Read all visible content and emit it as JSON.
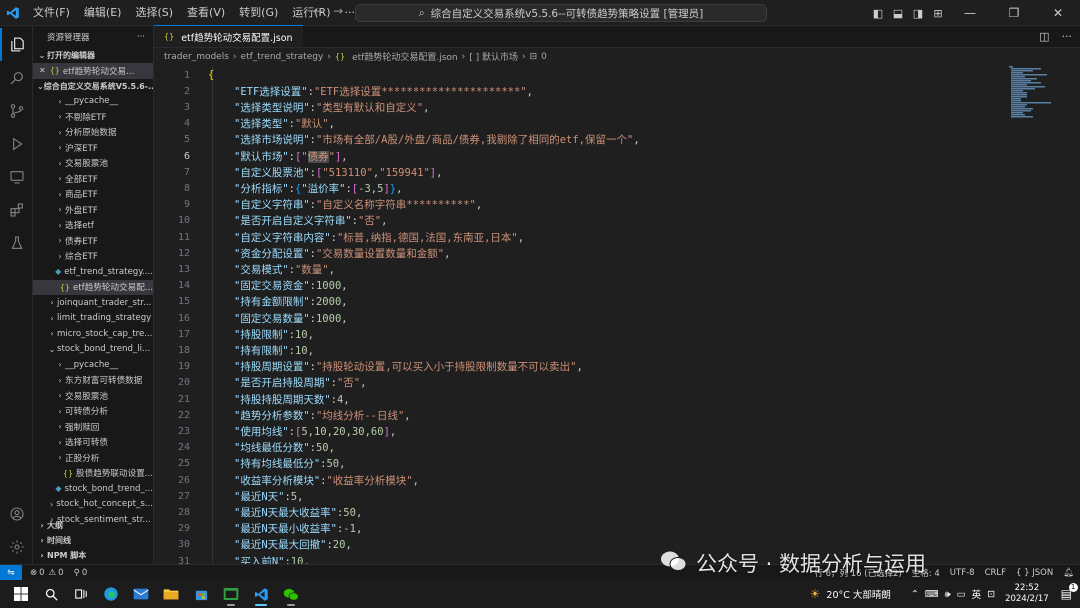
{
  "titlebar": {
    "menus": [
      "文件(F)",
      "编辑(E)",
      "选择(S)",
      "查看(V)",
      "转到(G)",
      "运行(R)",
      "···"
    ],
    "command_center": "综合自定义交易系统v5.5.6--可转债趋势策略设置 [管理员]"
  },
  "sidebar": {
    "header": "资源管理器",
    "header_more": "···",
    "open_editors": "打开的编辑器",
    "open_file": "etf趋势轮动交易...",
    "root": "综合自定义交易系统V5.5.6-...",
    "items": [
      {
        "label": "__pycache__",
        "indent": 2,
        "chev": "›",
        "type": "folder"
      },
      {
        "label": "不剔除ETF",
        "indent": 2,
        "chev": "›",
        "type": "folder"
      },
      {
        "label": "分析原始数据",
        "indent": 2,
        "chev": "›",
        "type": "folder"
      },
      {
        "label": "沪深ETF",
        "indent": 2,
        "chev": "›",
        "type": "folder"
      },
      {
        "label": "交易股票池",
        "indent": 2,
        "chev": "›",
        "type": "folder"
      },
      {
        "label": "全部ETF",
        "indent": 2,
        "chev": "›",
        "type": "folder"
      },
      {
        "label": "商品ETF",
        "indent": 2,
        "chev": "›",
        "type": "folder"
      },
      {
        "label": "外盘ETF",
        "indent": 2,
        "chev": "›",
        "type": "folder"
      },
      {
        "label": "选择etf",
        "indent": 2,
        "chev": "›",
        "type": "folder"
      },
      {
        "label": "债券ETF",
        "indent": 2,
        "chev": "›",
        "type": "folder"
      },
      {
        "label": "综合ETF",
        "indent": 2,
        "chev": "›",
        "type": "folder"
      },
      {
        "label": "etf_trend_strategy....",
        "indent": 2,
        "chev": "",
        "type": "py"
      },
      {
        "label": "etf趋势轮动交易配...",
        "indent": 2,
        "chev": "",
        "type": "json",
        "selected": true
      },
      {
        "label": "joinquant_trader_str...",
        "indent": 1,
        "chev": "›",
        "type": "folder"
      },
      {
        "label": "limit_trading_strategy",
        "indent": 1,
        "chev": "›",
        "type": "folder"
      },
      {
        "label": "micro_stock_cap_tre...",
        "indent": 1,
        "chev": "›",
        "type": "folder"
      },
      {
        "label": "stock_bond_trend_li...",
        "indent": 1,
        "chev": "⌄",
        "type": "folder"
      },
      {
        "label": "__pycache__",
        "indent": 2,
        "chev": "›",
        "type": "folder"
      },
      {
        "label": "东方财富可转债数据",
        "indent": 2,
        "chev": "›",
        "type": "folder"
      },
      {
        "label": "交易股票池",
        "indent": 2,
        "chev": "›",
        "type": "folder"
      },
      {
        "label": "可转债分析",
        "indent": 2,
        "chev": "›",
        "type": "folder"
      },
      {
        "label": "强制赎回",
        "indent": 2,
        "chev": "›",
        "type": "folder"
      },
      {
        "label": "选择可转债",
        "indent": 2,
        "chev": "›",
        "type": "folder"
      },
      {
        "label": "正股分析",
        "indent": 2,
        "chev": "›",
        "type": "folder"
      },
      {
        "label": "股债趋势联动设置...",
        "indent": 2,
        "chev": "",
        "type": "json"
      },
      {
        "label": "stock_bond_trend_...",
        "indent": 2,
        "chev": "",
        "type": "py"
      },
      {
        "label": "stock_hot_concept_s...",
        "indent": 1,
        "chev": "›",
        "type": "folder"
      },
      {
        "label": "stock_sentiment_str...",
        "indent": 1,
        "chev": "›",
        "type": "folder"
      }
    ],
    "bottom_sections": [
      "大纲",
      "时间线",
      "NPM 脚本"
    ]
  },
  "editor": {
    "tab_label": "etf趋势轮动交易配置.json",
    "breadcrumb": [
      "trader_models",
      "etf_trend_strategy",
      "etf趋势轮动交易配置.json",
      "[ ] 默认市场",
      "0"
    ],
    "current_line": 6,
    "lines": [
      {
        "n": "1",
        "text": "{"
      },
      {
        "n": "2",
        "text": "\"ETF选择设置\":\"ETF选择设置**********************\","
      },
      {
        "n": "3",
        "text": "\"选择类型说明\":\"类型有默认和自定义\","
      },
      {
        "n": "4",
        "text": "\"选择类型\":\"默认\","
      },
      {
        "n": "5",
        "text": "\"选择市场说明\":\"市场有全部/A股/外盘/商品/债券,我剔除了相同的etf,保留一个\","
      },
      {
        "n": "6",
        "text": "\"默认市场\":[\"债券\"],"
      },
      {
        "n": "7",
        "text": "\"自定义股票池\":[\"513110\",\"159941\"],"
      },
      {
        "n": "8",
        "text": "\"分析指标\":{\"溢价率\":[-3,5]},"
      },
      {
        "n": "9",
        "text": "\"自定义字符串\":\"自定义名称字符串**********\","
      },
      {
        "n": "10",
        "text": "\"是否开启自定义字符串\":\"否\","
      },
      {
        "n": "11",
        "text": "\"自定义字符串内容\":\"标普,纳指,德国,法国,东南亚,日本\","
      },
      {
        "n": "12",
        "text": "\"资金分配设置\":\"交易数量设置数量和金额\","
      },
      {
        "n": "13",
        "text": "\"交易模式\":\"数量\","
      },
      {
        "n": "14",
        "text": "\"固定交易资金\":1000,"
      },
      {
        "n": "15",
        "text": "\"持有金额限制\":2000,"
      },
      {
        "n": "16",
        "text": "\"固定交易数量\":1000,"
      },
      {
        "n": "17",
        "text": "\"持股限制\":10,"
      },
      {
        "n": "18",
        "text": "\"持有限制\":10,"
      },
      {
        "n": "19",
        "text": "\"持股周期设置\":\"持股轮动设置,可以买入小于持股限制数量不可以卖出\","
      },
      {
        "n": "20",
        "text": "\"是否开启持股周期\":\"否\","
      },
      {
        "n": "21",
        "text": "\"持股持股周期天数\":4,"
      },
      {
        "n": "22",
        "text": "\"趋势分析参数\":\"均线分析--日线\","
      },
      {
        "n": "23",
        "text": "\"使用均线\":[5,10,20,30,60],"
      },
      {
        "n": "24",
        "text": "\"均线最低分数\":50,"
      },
      {
        "n": "25",
        "text": "\"持有均线最低分\":50,"
      },
      {
        "n": "26",
        "text": "\"收益率分析模块\":\"收益率分析模块\","
      },
      {
        "n": "27",
        "text": "\"最近N天\":5,"
      },
      {
        "n": "28",
        "text": "\"最近N天最大收益率\":50,"
      },
      {
        "n": "29",
        "text": "\"最近N天最小收益率\":-1,"
      },
      {
        "n": "30",
        "text": "\"最近N天最大回撤\":20,"
      },
      {
        "n": "31",
        "text": "\"买入前N\":10,"
      }
    ]
  },
  "statusbar": {
    "errors": "0",
    "warnings": "0",
    "ports": "0",
    "right": [
      "行 6，列 16 (已选择2)",
      "空格: 4",
      "UTF-8",
      "CRLF",
      "{ } JSON"
    ]
  },
  "taskbar": {
    "weather": "20°C  大部晴朗",
    "ime": "英",
    "time": "22:52",
    "date": "2024/2/17",
    "notifications": "1"
  },
  "watermark": "公众号 · 数据分析与运用",
  "colors": {
    "accent": "#0078d4",
    "key": "#9cdcfe",
    "string": "#ce9178",
    "number": "#b5cea8",
    "bracket": "#ffd700"
  }
}
